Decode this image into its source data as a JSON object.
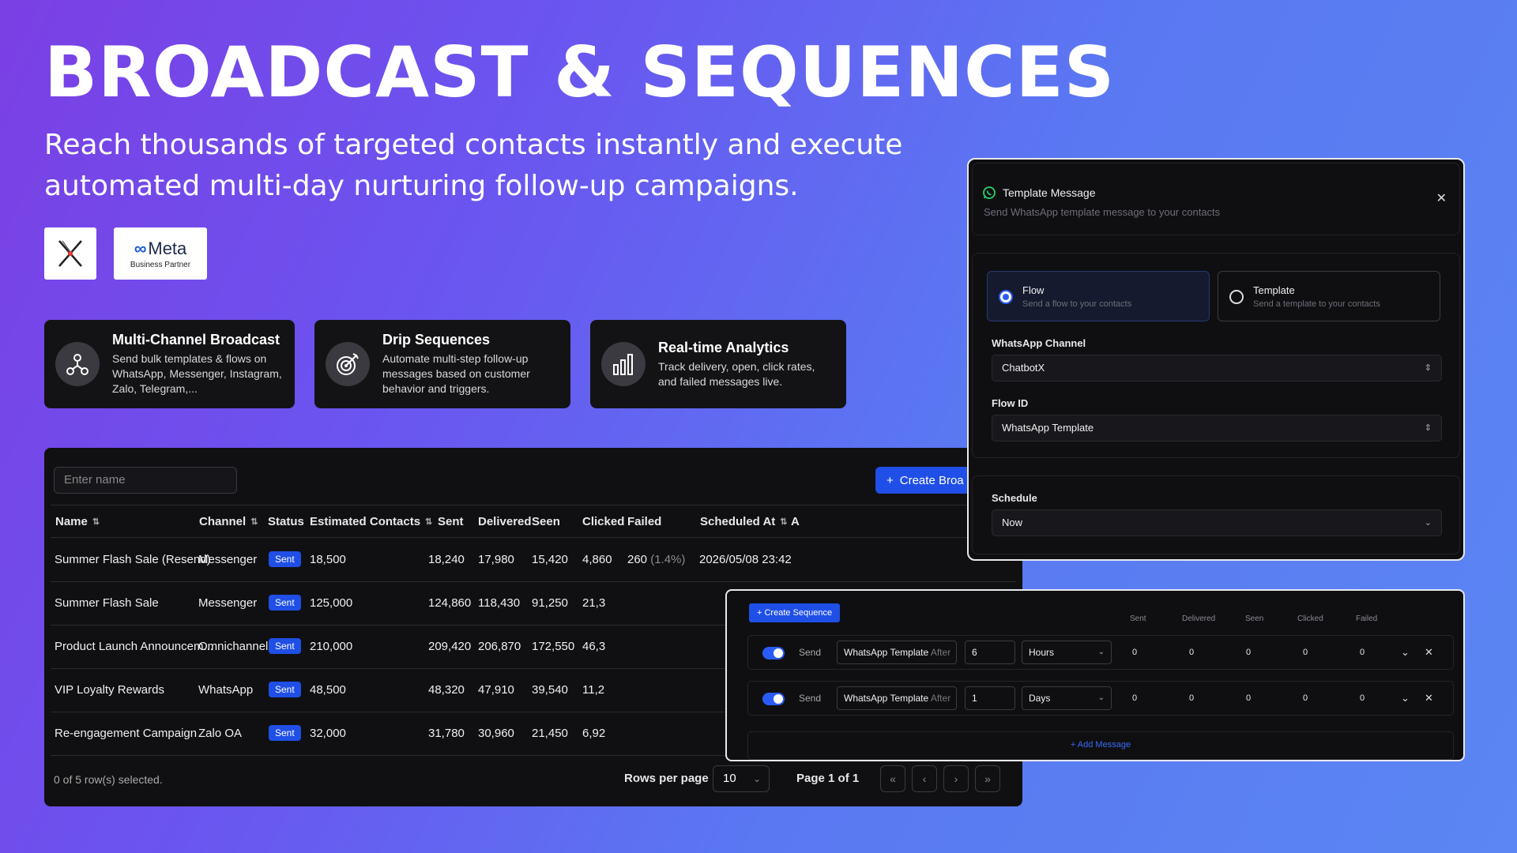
{
  "hero": {
    "title": "BROADCAST & SEQUENCES",
    "subtitle_line1": "Reach thousands of targeted contacts instantly and execute",
    "subtitle_line2": "automated multi-day nurturing follow-up campaigns."
  },
  "badges": {
    "meta_name": "Meta",
    "meta_sub": "Business Partner"
  },
  "features": [
    {
      "title": "Multi-Channel Broadcast",
      "desc": "Send bulk templates & flows on WhatsApp, Messenger, Instagram, Zalo, Telegram,...",
      "icon": "network-icon"
    },
    {
      "title": "Drip Sequences",
      "desc": "Automate multi-step follow-up messages based on customer behavior and triggers.",
      "icon": "target-icon"
    },
    {
      "title": "Real-time Analytics",
      "desc": "Track delivery, open, click rates, and failed messages live.",
      "icon": "bar-chart-icon"
    }
  ],
  "table": {
    "search_placeholder": "Enter name",
    "create_label": "Create Broa",
    "headers": {
      "name": "Name",
      "channel": "Channel",
      "status": "Status",
      "estimated": "Estimated Contacts",
      "sent": "Sent",
      "delivered": "Delivered",
      "seen": "Seen",
      "clicked": "Clicked",
      "failed": "Failed",
      "scheduled": "Scheduled At",
      "actions": "A"
    },
    "rows": [
      {
        "name": "Summer Flash Sale (Resend)",
        "channel": "Messenger",
        "status": "Sent",
        "estimated": "18,500",
        "sent": "18,240",
        "delivered": "17,980",
        "seen": "15,420",
        "clicked": "4,860",
        "failed": "260",
        "failed_pct": "(1.4%)",
        "scheduled": "2026/05/08 23:42"
      },
      {
        "name": "Summer Flash Sale",
        "channel": "Messenger",
        "status": "Sent",
        "estimated": "125,000",
        "sent": "124,860",
        "delivered": "118,430",
        "seen": "91,250",
        "clicked": "21,3"
      },
      {
        "name": "Product Launch Announcem...",
        "channel": "Omnichannel",
        "status": "Sent",
        "estimated": "210,000",
        "sent": "209,420",
        "delivered": "206,870",
        "seen": "172,550",
        "clicked": "46,3"
      },
      {
        "name": "VIP Loyalty Rewards",
        "channel": "WhatsApp",
        "status": "Sent",
        "estimated": "48,500",
        "sent": "48,320",
        "delivered": "47,910",
        "seen": "39,540",
        "clicked": "11,2"
      },
      {
        "name": "Re-engagement Campaign",
        "channel": "Zalo OA",
        "status": "Sent",
        "estimated": "32,000",
        "sent": "31,780",
        "delivered": "30,960",
        "seen": "21,450",
        "clicked": "6,92"
      }
    ],
    "selection": "0 of 5 row(s) selected.",
    "rows_per_page_label": "Rows per page",
    "rows_per_page": "10",
    "page_info": "Page 1 of 1"
  },
  "modal": {
    "title": "Template Message",
    "subtitle": "Send WhatsApp template message to your contacts",
    "option_flow": {
      "label": "Flow",
      "desc": "Send a flow to your contacts"
    },
    "option_template": {
      "label": "Template",
      "desc": "Send a template to your contacts"
    },
    "channel_label": "WhatsApp Channel",
    "channel_value": "ChatbotX",
    "flow_label": "Flow ID",
    "flow_value": "WhatsApp Template",
    "schedule_label": "Schedule",
    "schedule_value": "Now"
  },
  "sequence": {
    "create_label": "Create Sequence",
    "headers": {
      "sent": "Sent",
      "delivered": "Delivered",
      "seen": "Seen",
      "clicked": "Clicked",
      "failed": "Failed"
    },
    "steps": [
      {
        "send": "Send",
        "template": "WhatsApp Template",
        "after": "After",
        "amount": "6",
        "unit": "Hours",
        "sent": "0",
        "delivered": "0",
        "seen": "0",
        "clicked": "0",
        "failed": "0"
      },
      {
        "send": "Send",
        "template": "WhatsApp Template",
        "after": "After",
        "amount": "1",
        "unit": "Days",
        "sent": "0",
        "delivered": "0",
        "seen": "0",
        "clicked": "0",
        "failed": "0"
      }
    ],
    "add_label": "+ Add Message"
  },
  "colors": {
    "accent": "#1f4fe6",
    "panel": "#101012"
  }
}
